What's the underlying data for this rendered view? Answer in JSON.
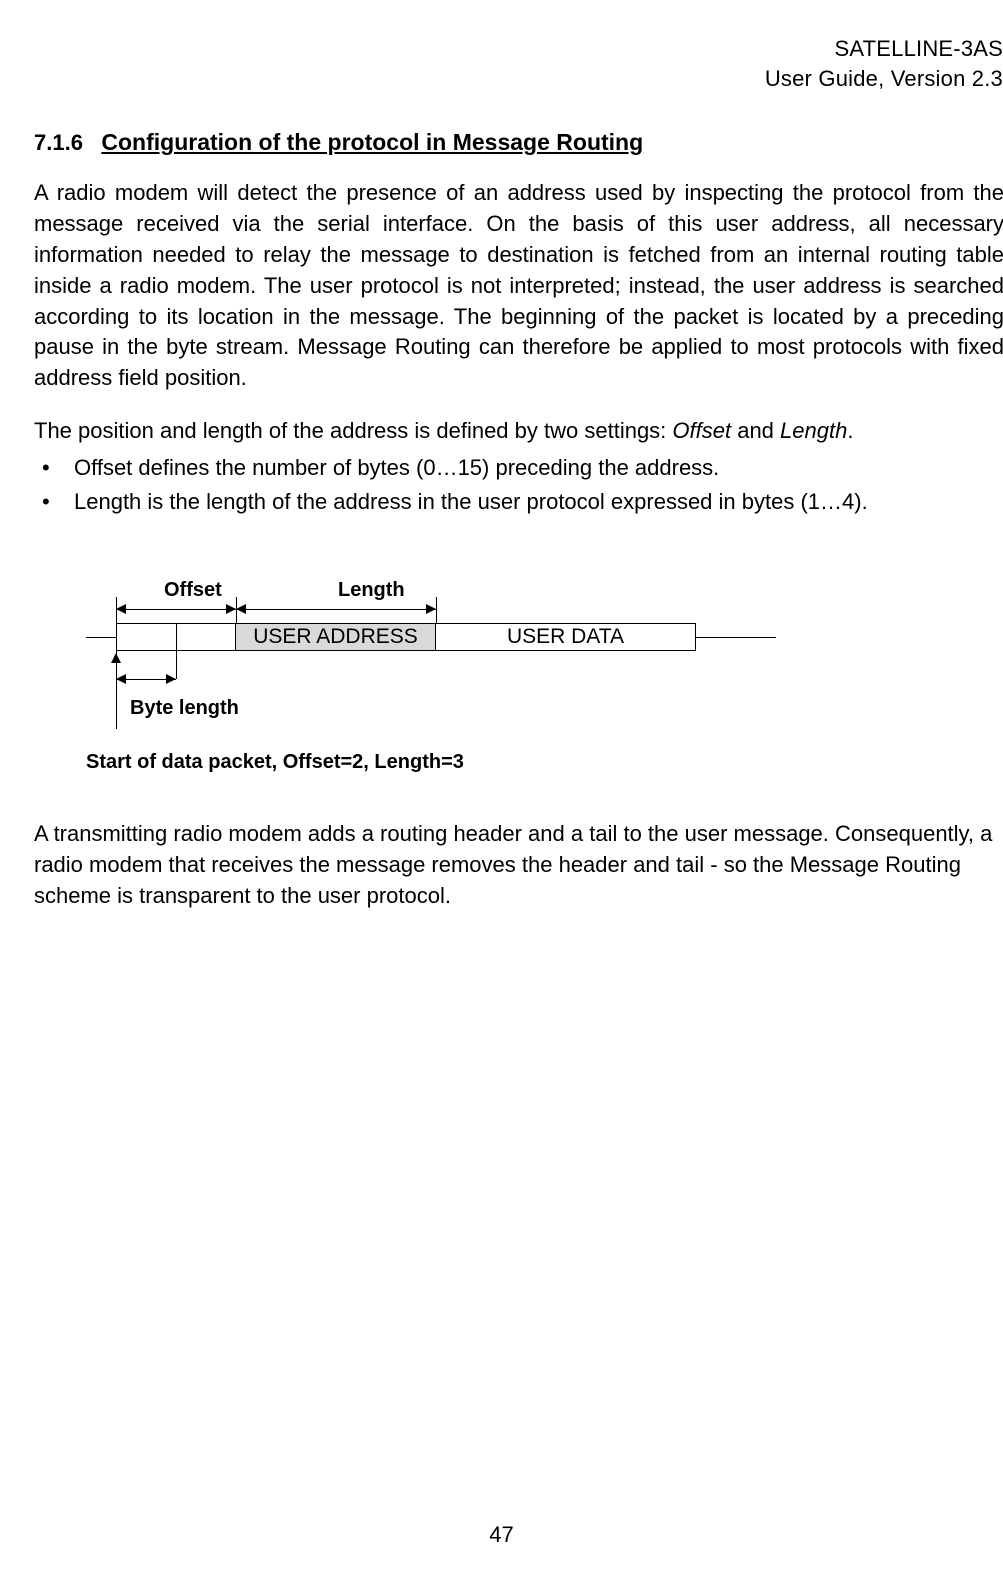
{
  "header": {
    "product": "SATELLINE-3AS",
    "guide": "User Guide, Version 2.3"
  },
  "section": {
    "number": "7.1.6",
    "title": "Configuration of the protocol in Message Routing"
  },
  "para1": "A radio modem will detect the presence of an address used by inspecting the protocol from the message received via the serial interface. On the basis of this user address, all necessary information needed to relay the message to destination is fetched from an internal routing table inside a radio modem. The user protocol is not interpreted; instead, the user address is searched according to its location in the message. The beginning of the packet is located by a preceding pause in the byte stream. Message Routing can therefore be applied to most protocols with fixed address field position.",
  "para2_prefix": "The position and length of the address is defined by two settings: ",
  "para2_italic1": "Offset",
  "para2_mid": " and ",
  "para2_italic2": "Length",
  "para2_suffix": ".",
  "bullets": [
    "Offset defines the number of bytes (0…15) preceding the address.",
    "Length is the length of the address in the user protocol expressed in bytes (1…4)."
  ],
  "diagram": {
    "offset": "Offset",
    "length": "Length",
    "user_address": "USER ADDRESS",
    "user_data": "USER DATA",
    "byte_length": "Byte length",
    "caption": "Start of data packet, Offset=2, Length=3"
  },
  "para3": "A transmitting radio modem adds a routing header and a tail to the user message. Consequently, a radio modem that receives the message removes the header and tail - so the Message Routing scheme is transparent to the user protocol.",
  "page_number": "47"
}
